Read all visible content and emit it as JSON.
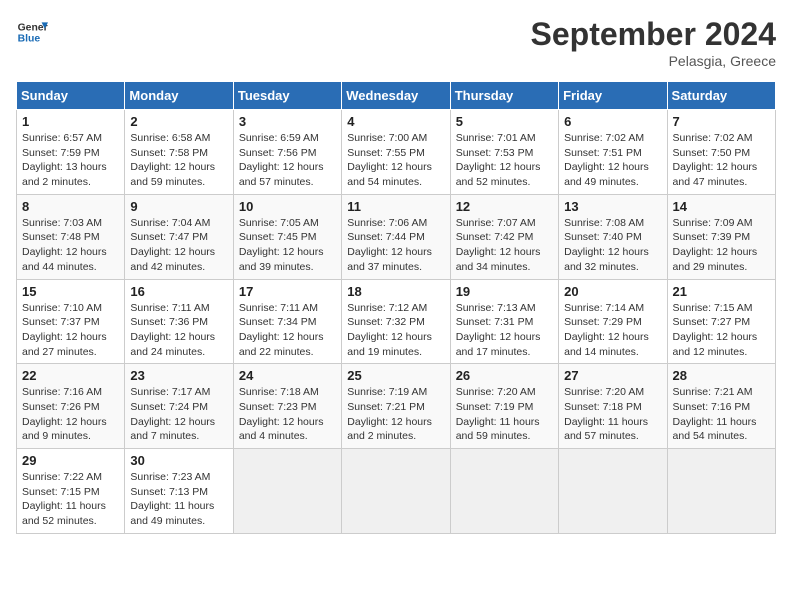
{
  "header": {
    "logo_line1": "General",
    "logo_line2": "Blue",
    "month_title": "September 2024",
    "subtitle": "Pelasgia, Greece"
  },
  "days_of_week": [
    "Sunday",
    "Monday",
    "Tuesday",
    "Wednesday",
    "Thursday",
    "Friday",
    "Saturday"
  ],
  "weeks": [
    [
      {
        "day": "1",
        "info": "Sunrise: 6:57 AM\nSunset: 7:59 PM\nDaylight: 13 hours\nand 2 minutes."
      },
      {
        "day": "2",
        "info": "Sunrise: 6:58 AM\nSunset: 7:58 PM\nDaylight: 12 hours\nand 59 minutes."
      },
      {
        "day": "3",
        "info": "Sunrise: 6:59 AM\nSunset: 7:56 PM\nDaylight: 12 hours\nand 57 minutes."
      },
      {
        "day": "4",
        "info": "Sunrise: 7:00 AM\nSunset: 7:55 PM\nDaylight: 12 hours\nand 54 minutes."
      },
      {
        "day": "5",
        "info": "Sunrise: 7:01 AM\nSunset: 7:53 PM\nDaylight: 12 hours\nand 52 minutes."
      },
      {
        "day": "6",
        "info": "Sunrise: 7:02 AM\nSunset: 7:51 PM\nDaylight: 12 hours\nand 49 minutes."
      },
      {
        "day": "7",
        "info": "Sunrise: 7:02 AM\nSunset: 7:50 PM\nDaylight: 12 hours\nand 47 minutes."
      }
    ],
    [
      {
        "day": "8",
        "info": "Sunrise: 7:03 AM\nSunset: 7:48 PM\nDaylight: 12 hours\nand 44 minutes."
      },
      {
        "day": "9",
        "info": "Sunrise: 7:04 AM\nSunset: 7:47 PM\nDaylight: 12 hours\nand 42 minutes."
      },
      {
        "day": "10",
        "info": "Sunrise: 7:05 AM\nSunset: 7:45 PM\nDaylight: 12 hours\nand 39 minutes."
      },
      {
        "day": "11",
        "info": "Sunrise: 7:06 AM\nSunset: 7:44 PM\nDaylight: 12 hours\nand 37 minutes."
      },
      {
        "day": "12",
        "info": "Sunrise: 7:07 AM\nSunset: 7:42 PM\nDaylight: 12 hours\nand 34 minutes."
      },
      {
        "day": "13",
        "info": "Sunrise: 7:08 AM\nSunset: 7:40 PM\nDaylight: 12 hours\nand 32 minutes."
      },
      {
        "day": "14",
        "info": "Sunrise: 7:09 AM\nSunset: 7:39 PM\nDaylight: 12 hours\nand 29 minutes."
      }
    ],
    [
      {
        "day": "15",
        "info": "Sunrise: 7:10 AM\nSunset: 7:37 PM\nDaylight: 12 hours\nand 27 minutes."
      },
      {
        "day": "16",
        "info": "Sunrise: 7:11 AM\nSunset: 7:36 PM\nDaylight: 12 hours\nand 24 minutes."
      },
      {
        "day": "17",
        "info": "Sunrise: 7:11 AM\nSunset: 7:34 PM\nDaylight: 12 hours\nand 22 minutes."
      },
      {
        "day": "18",
        "info": "Sunrise: 7:12 AM\nSunset: 7:32 PM\nDaylight: 12 hours\nand 19 minutes."
      },
      {
        "day": "19",
        "info": "Sunrise: 7:13 AM\nSunset: 7:31 PM\nDaylight: 12 hours\nand 17 minutes."
      },
      {
        "day": "20",
        "info": "Sunrise: 7:14 AM\nSunset: 7:29 PM\nDaylight: 12 hours\nand 14 minutes."
      },
      {
        "day": "21",
        "info": "Sunrise: 7:15 AM\nSunset: 7:27 PM\nDaylight: 12 hours\nand 12 minutes."
      }
    ],
    [
      {
        "day": "22",
        "info": "Sunrise: 7:16 AM\nSunset: 7:26 PM\nDaylight: 12 hours\nand 9 minutes."
      },
      {
        "day": "23",
        "info": "Sunrise: 7:17 AM\nSunset: 7:24 PM\nDaylight: 12 hours\nand 7 minutes."
      },
      {
        "day": "24",
        "info": "Sunrise: 7:18 AM\nSunset: 7:23 PM\nDaylight: 12 hours\nand 4 minutes."
      },
      {
        "day": "25",
        "info": "Sunrise: 7:19 AM\nSunset: 7:21 PM\nDaylight: 12 hours\nand 2 minutes."
      },
      {
        "day": "26",
        "info": "Sunrise: 7:20 AM\nSunset: 7:19 PM\nDaylight: 11 hours\nand 59 minutes."
      },
      {
        "day": "27",
        "info": "Sunrise: 7:20 AM\nSunset: 7:18 PM\nDaylight: 11 hours\nand 57 minutes."
      },
      {
        "day": "28",
        "info": "Sunrise: 7:21 AM\nSunset: 7:16 PM\nDaylight: 11 hours\nand 54 minutes."
      }
    ],
    [
      {
        "day": "29",
        "info": "Sunrise: 7:22 AM\nSunset: 7:15 PM\nDaylight: 11 hours\nand 52 minutes."
      },
      {
        "day": "30",
        "info": "Sunrise: 7:23 AM\nSunset: 7:13 PM\nDaylight: 11 hours\nand 49 minutes."
      },
      {
        "day": "",
        "info": ""
      },
      {
        "day": "",
        "info": ""
      },
      {
        "day": "",
        "info": ""
      },
      {
        "day": "",
        "info": ""
      },
      {
        "day": "",
        "info": ""
      }
    ]
  ]
}
